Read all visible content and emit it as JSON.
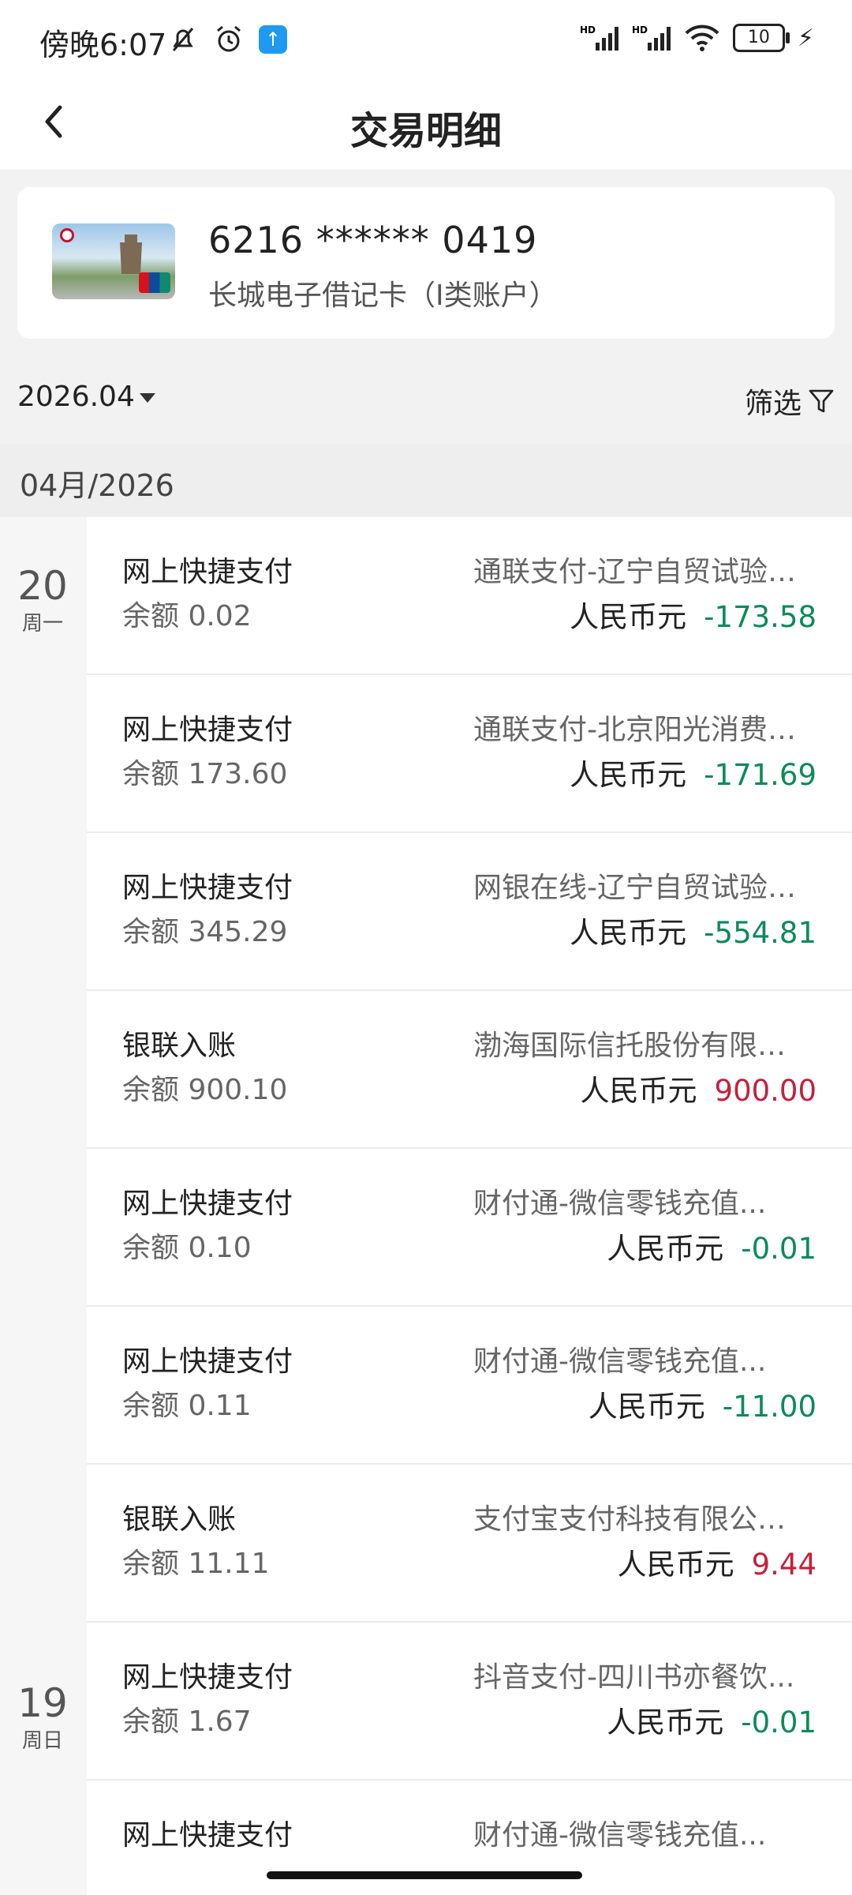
{
  "status_bar": {
    "time": "傍晚6:07",
    "battery": "10",
    "icons": [
      "mute-bell-icon",
      "alarm-icon",
      "upload-icon",
      "signal-hd-icon",
      "signal-hd-icon",
      "wifi-icon",
      "battery-icon",
      "charging-icon"
    ]
  },
  "header": {
    "title": "交易明细",
    "back_icon": "chevron-left-icon"
  },
  "card": {
    "number": "6216 ****** 0419",
    "type": "长城电子借记卡（I类账户）"
  },
  "filter": {
    "month": "2026.04",
    "filter_label": "筛选"
  },
  "month_header": "04月/2026",
  "dates": [
    {
      "day": "20",
      "week": "周一"
    },
    {
      "day": "19",
      "week": "周日"
    }
  ],
  "transactions": [
    {
      "type": "网上快捷支付",
      "balance": "余额 0.02",
      "merchant": "通联支付-辽宁自贸试验区...",
      "currency": "人民币元",
      "amount": "-173.58",
      "direction": "out"
    },
    {
      "type": "网上快捷支付",
      "balance": "余额 173.60",
      "merchant": "通联支付-北京阳光消费金...",
      "currency": "人民币元",
      "amount": "-171.69",
      "direction": "out"
    },
    {
      "type": "网上快捷支付",
      "balance": "余额 345.29",
      "merchant": "网银在线-辽宁自贸试验区...",
      "currency": "人民币元",
      "amount": "-554.81",
      "direction": "out"
    },
    {
      "type": "银联入账",
      "balance": "余额 900.10",
      "merchant": "渤海国际信托股份有限公司...",
      "currency": "人民币元",
      "amount": "900.00",
      "direction": "in"
    },
    {
      "type": "网上快捷支付",
      "balance": "余额 0.10",
      "merchant": "财付通-微信零钱充值...",
      "currency": "人民币元",
      "amount": "-0.01",
      "direction": "out"
    },
    {
      "type": "网上快捷支付",
      "balance": "余额 0.11",
      "merchant": "财付通-微信零钱充值...",
      "currency": "人民币元",
      "amount": "-11.00",
      "direction": "out"
    },
    {
      "type": "银联入账",
      "balance": "余额 11.11",
      "merchant": "支付宝支付科技有限公司...",
      "currency": "人民币元",
      "amount": "9.44",
      "direction": "in"
    },
    {
      "type": "网上快捷支付",
      "balance": "余额 1.67",
      "merchant": "抖音支付-四川书亦餐饮...",
      "currency": "人民币元",
      "amount": "-0.01",
      "direction": "out"
    },
    {
      "type": "网上快捷支付",
      "balance": "",
      "merchant": "财付通-微信零钱充值...",
      "currency": "",
      "amount": "",
      "direction": "out"
    }
  ],
  "colors": {
    "expense": "#0c8a5a",
    "income": "#c4203d",
    "background": "#f2f2f2"
  }
}
